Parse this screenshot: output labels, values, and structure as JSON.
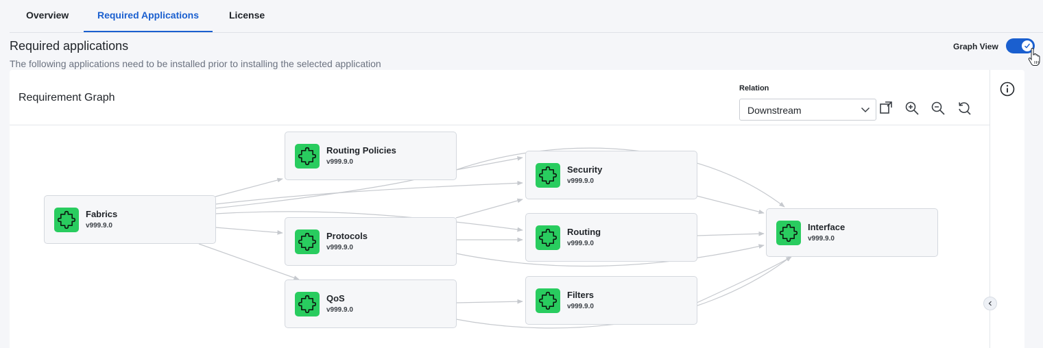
{
  "tabs": [
    {
      "label": "Overview",
      "active": false
    },
    {
      "label": "Required Applications",
      "active": true
    },
    {
      "label": "License",
      "active": false
    }
  ],
  "section": {
    "title": "Required applications",
    "subtitle": "The following applications need to be installed prior to installing the selected application"
  },
  "graph_view": {
    "label": "Graph View",
    "enabled": true
  },
  "graph": {
    "title": "Requirement Graph",
    "relation": {
      "label": "Relation",
      "value": "Downstream"
    },
    "tools": [
      "fit-view-icon",
      "zoom-in-icon",
      "zoom-out-icon",
      "reset-icon"
    ],
    "nodes": [
      {
        "id": "fabrics",
        "name": "Fabrics",
        "version": "v999.9.0"
      },
      {
        "id": "routing_policies",
        "name": "Routing Policies",
        "version": "v999.9.0"
      },
      {
        "id": "protocols",
        "name": "Protocols",
        "version": "v999.9.0"
      },
      {
        "id": "qos",
        "name": "QoS",
        "version": "v999.9.0"
      },
      {
        "id": "security",
        "name": "Security",
        "version": "v999.9.0"
      },
      {
        "id": "routing",
        "name": "Routing",
        "version": "v999.9.0"
      },
      {
        "id": "filters",
        "name": "Filters",
        "version": "v999.9.0"
      },
      {
        "id": "interface",
        "name": "Interface",
        "version": "v999.9.0"
      }
    ],
    "edges": [
      [
        "fabrics",
        "routing_policies"
      ],
      [
        "fabrics",
        "security"
      ],
      [
        "fabrics",
        "routing"
      ],
      [
        "fabrics",
        "protocols"
      ],
      [
        "fabrics",
        "qos"
      ],
      [
        "routing_policies",
        "security"
      ],
      [
        "routing_policies",
        "interface"
      ],
      [
        "protocols",
        "security"
      ],
      [
        "protocols",
        "routing"
      ],
      [
        "protocols",
        "interface"
      ],
      [
        "qos",
        "filters"
      ],
      [
        "qos",
        "interface"
      ],
      [
        "security",
        "interface"
      ],
      [
        "routing",
        "interface"
      ],
      [
        "filters",
        "interface"
      ]
    ]
  },
  "colors": {
    "accent": "#1a5fcf",
    "node_icon": "#29cc5f",
    "edge": "#c6c9ce"
  }
}
